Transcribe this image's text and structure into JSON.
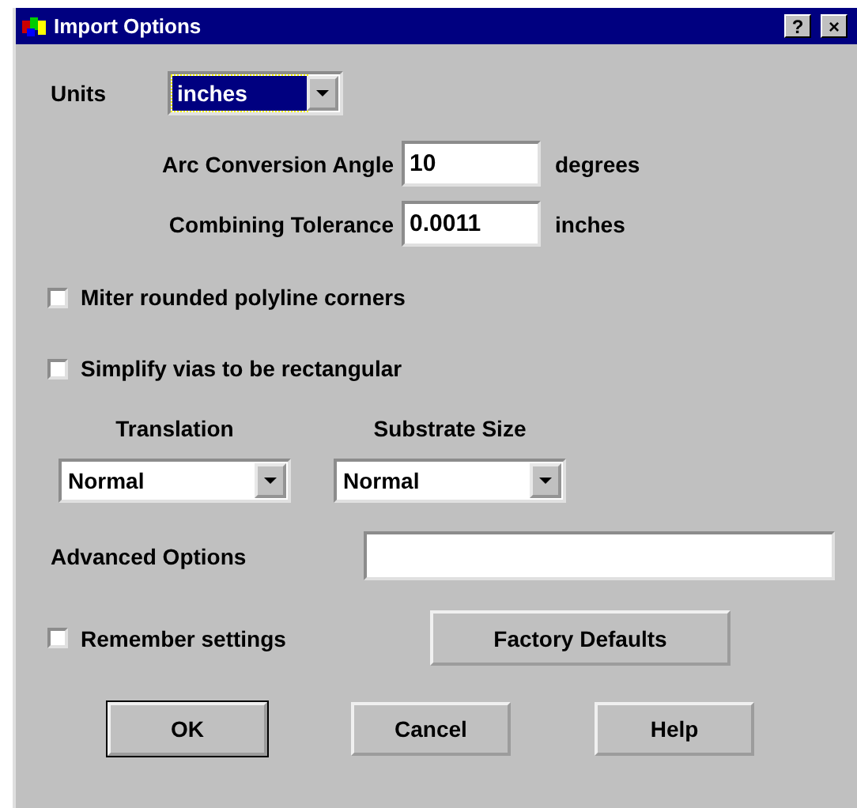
{
  "window": {
    "title": "Import Options",
    "title_buttons": [
      "?",
      "×"
    ]
  },
  "units": {
    "label": "Units",
    "value": "inches",
    "focused": true
  },
  "fields": [
    {
      "label": "Arc Conversion Angle",
      "value": "10",
      "unit": "degrees"
    },
    {
      "label": "Combining Tolerance",
      "value": "0.0011",
      "unit": "inches"
    }
  ],
  "checkboxes": [
    {
      "label": "Miter rounded polyline corners",
      "checked": false
    },
    {
      "label": "Simplify vias to be rectangular",
      "checked": false
    }
  ],
  "dropdowns": [
    {
      "label": "Translation",
      "value": "Normal"
    },
    {
      "label": "Substrate Size",
      "value": "Normal"
    }
  ],
  "advanced": {
    "label": "Advanced Options"
  },
  "remember": {
    "label": "Remember settings",
    "checked": false
  },
  "factory_button": "Factory Defaults",
  "buttons": [
    {
      "label": "OK",
      "default": true
    },
    {
      "label": "Cancel",
      "default": false
    },
    {
      "label": "Help",
      "default": false
    }
  ]
}
